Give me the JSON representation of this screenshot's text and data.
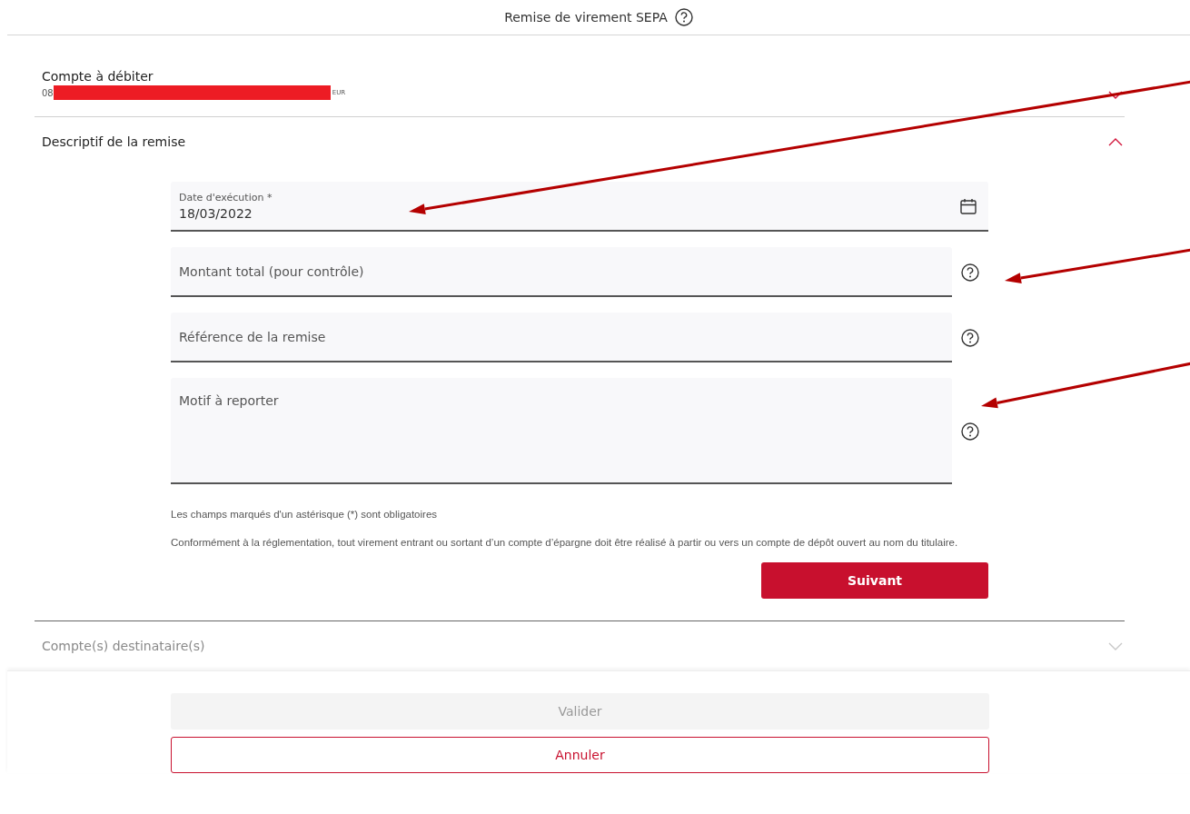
{
  "header": {
    "title": "Remise de virement SEPA",
    "help": true
  },
  "sections": [
    {
      "kind": "account",
      "title": "Compte à débiter",
      "expanded": false,
      "disabled": false,
      "account": {
        "prefix": "08",
        "redacted": true,
        "currency": "EUR"
      }
    },
    {
      "kind": "form",
      "title": "Descriptif de la remise",
      "expanded": true,
      "disabled": false,
      "fields": [
        {
          "kind": "date",
          "label": "Date d'exécution *",
          "value": "18/03/2022",
          "help": false
        },
        {
          "kind": "text",
          "placeholder": "Montant total (pour contrôle)",
          "help": true
        },
        {
          "kind": "text",
          "placeholder": "Référence de la remise",
          "help": true
        },
        {
          "kind": "textarea",
          "placeholder": "Motif à reporter",
          "help": true
        }
      ],
      "notes": [
        "Les champs marqués d'un astérisque (*) sont obligatoires",
        "Conformément à la réglementation, tout virement entrant ou sortant d’un compte d’épargne doit être réalisé à partir ou vers un compte de dépôt ouvert au nom du titulaire."
      ],
      "next_button": "Suivant"
    },
    {
      "kind": "plain",
      "title": "Compte(s) destinataire(s)",
      "expanded": false,
      "disabled": true
    }
  ],
  "footer": {
    "validate_button": {
      "label": "Valider",
      "disabled": true
    },
    "cancel_button": "Annuler"
  }
}
